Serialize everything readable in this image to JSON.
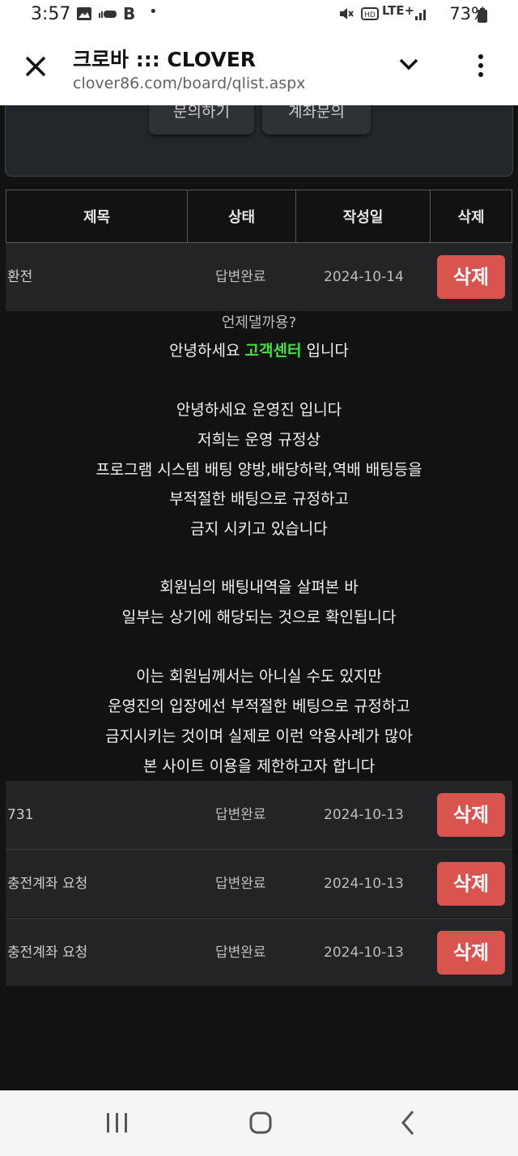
{
  "status_bar": {
    "time": "3:57",
    "network": "LTE+",
    "battery": "73%"
  },
  "browser": {
    "title": "크로바 ::: CLOVER",
    "url": "clover86.com/board/qlist.aspx"
  },
  "top_buttons": [
    "문의하기",
    "계좌문의"
  ],
  "table": {
    "headers": [
      "제목",
      "상태",
      "작성일",
      "삭제"
    ],
    "rows": [
      {
        "title": "환전",
        "status": "답변완료",
        "date": "2024-10-14",
        "delete": "삭제"
      },
      {
        "title": "731",
        "status": "답변완료",
        "date": "2024-10-13",
        "delete": "삭제"
      },
      {
        "title": "충전계좌 요청",
        "status": "답변완료",
        "date": "2024-10-13",
        "delete": "삭제"
      },
      {
        "title": "충전계좌 요청",
        "status": "답변완료",
        "date": "2024-10-13",
        "delete": "삭제"
      }
    ]
  },
  "answer": {
    "question": "언제댈까용?",
    "greeting_prefix": "안녕하세요 ",
    "greeting_highlight": "고객센터",
    "greeting_suffix": " 입니다",
    "lines": [
      "안녕하세요 운영진 입니다",
      "저희는 운영 규정상",
      "프로그램 시스템 배팅 양방,배당하락,역배 배팅등을",
      "부적절한 배팅으로 규정하고",
      "금지 시키고 있습니다",
      "회원님의 배팅내역을 살펴본 바",
      "일부는 상기에 해당되는 것으로 확인됩니다",
      "이는 회원님께서는 아니실 수도 있지만",
      "운영진의 입장에선 부적절한 베팅으로 규정하고",
      "금지시키는 것이며 실제로 이런 악용사례가 많아",
      "본 사이트 이용을 제한하고자 합니다"
    ]
  },
  "colors": {
    "delete_button": "#d9534f",
    "highlight": "#3ee53e",
    "row_bg": "#222426",
    "page_bg": "#121212"
  }
}
